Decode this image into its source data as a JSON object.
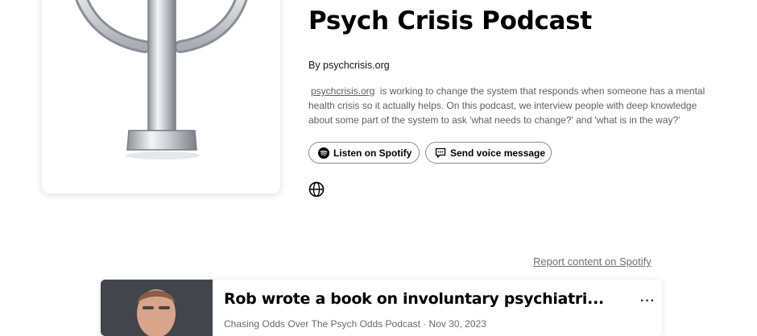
{
  "podcast": {
    "title": "Psych Crisis Podcast",
    "byline": "By psychcrisis.org",
    "description_link": "psychcrisis.org",
    "description_text": "is working to change the system that responds when someone has a mental health crisis so it actually helps. On this podcast, we interview people with deep knowledge about some part of the system to ask 'what needs to change?' and 'what is in the way?'"
  },
  "actions": {
    "listen_label": "Listen on Spotify",
    "voice_label": "Send voice message"
  },
  "icons": {
    "cover": "psi-symbol-icon",
    "spotify": "spotify-icon",
    "voice": "message-icon",
    "website": "globe-icon",
    "episode_menu": "more-icon"
  },
  "report_label": "Report content on Spotify",
  "episode": {
    "title": "Rob wrote a book on involuntary psychiatri...",
    "meta": "Chasing Odds Over The Psych Odds Podcast · Nov 30, 2023",
    "more_label": "···"
  },
  "colors": {
    "text": "#000000",
    "muted": "#5e5e5e",
    "border": "#8a8a8a"
  }
}
